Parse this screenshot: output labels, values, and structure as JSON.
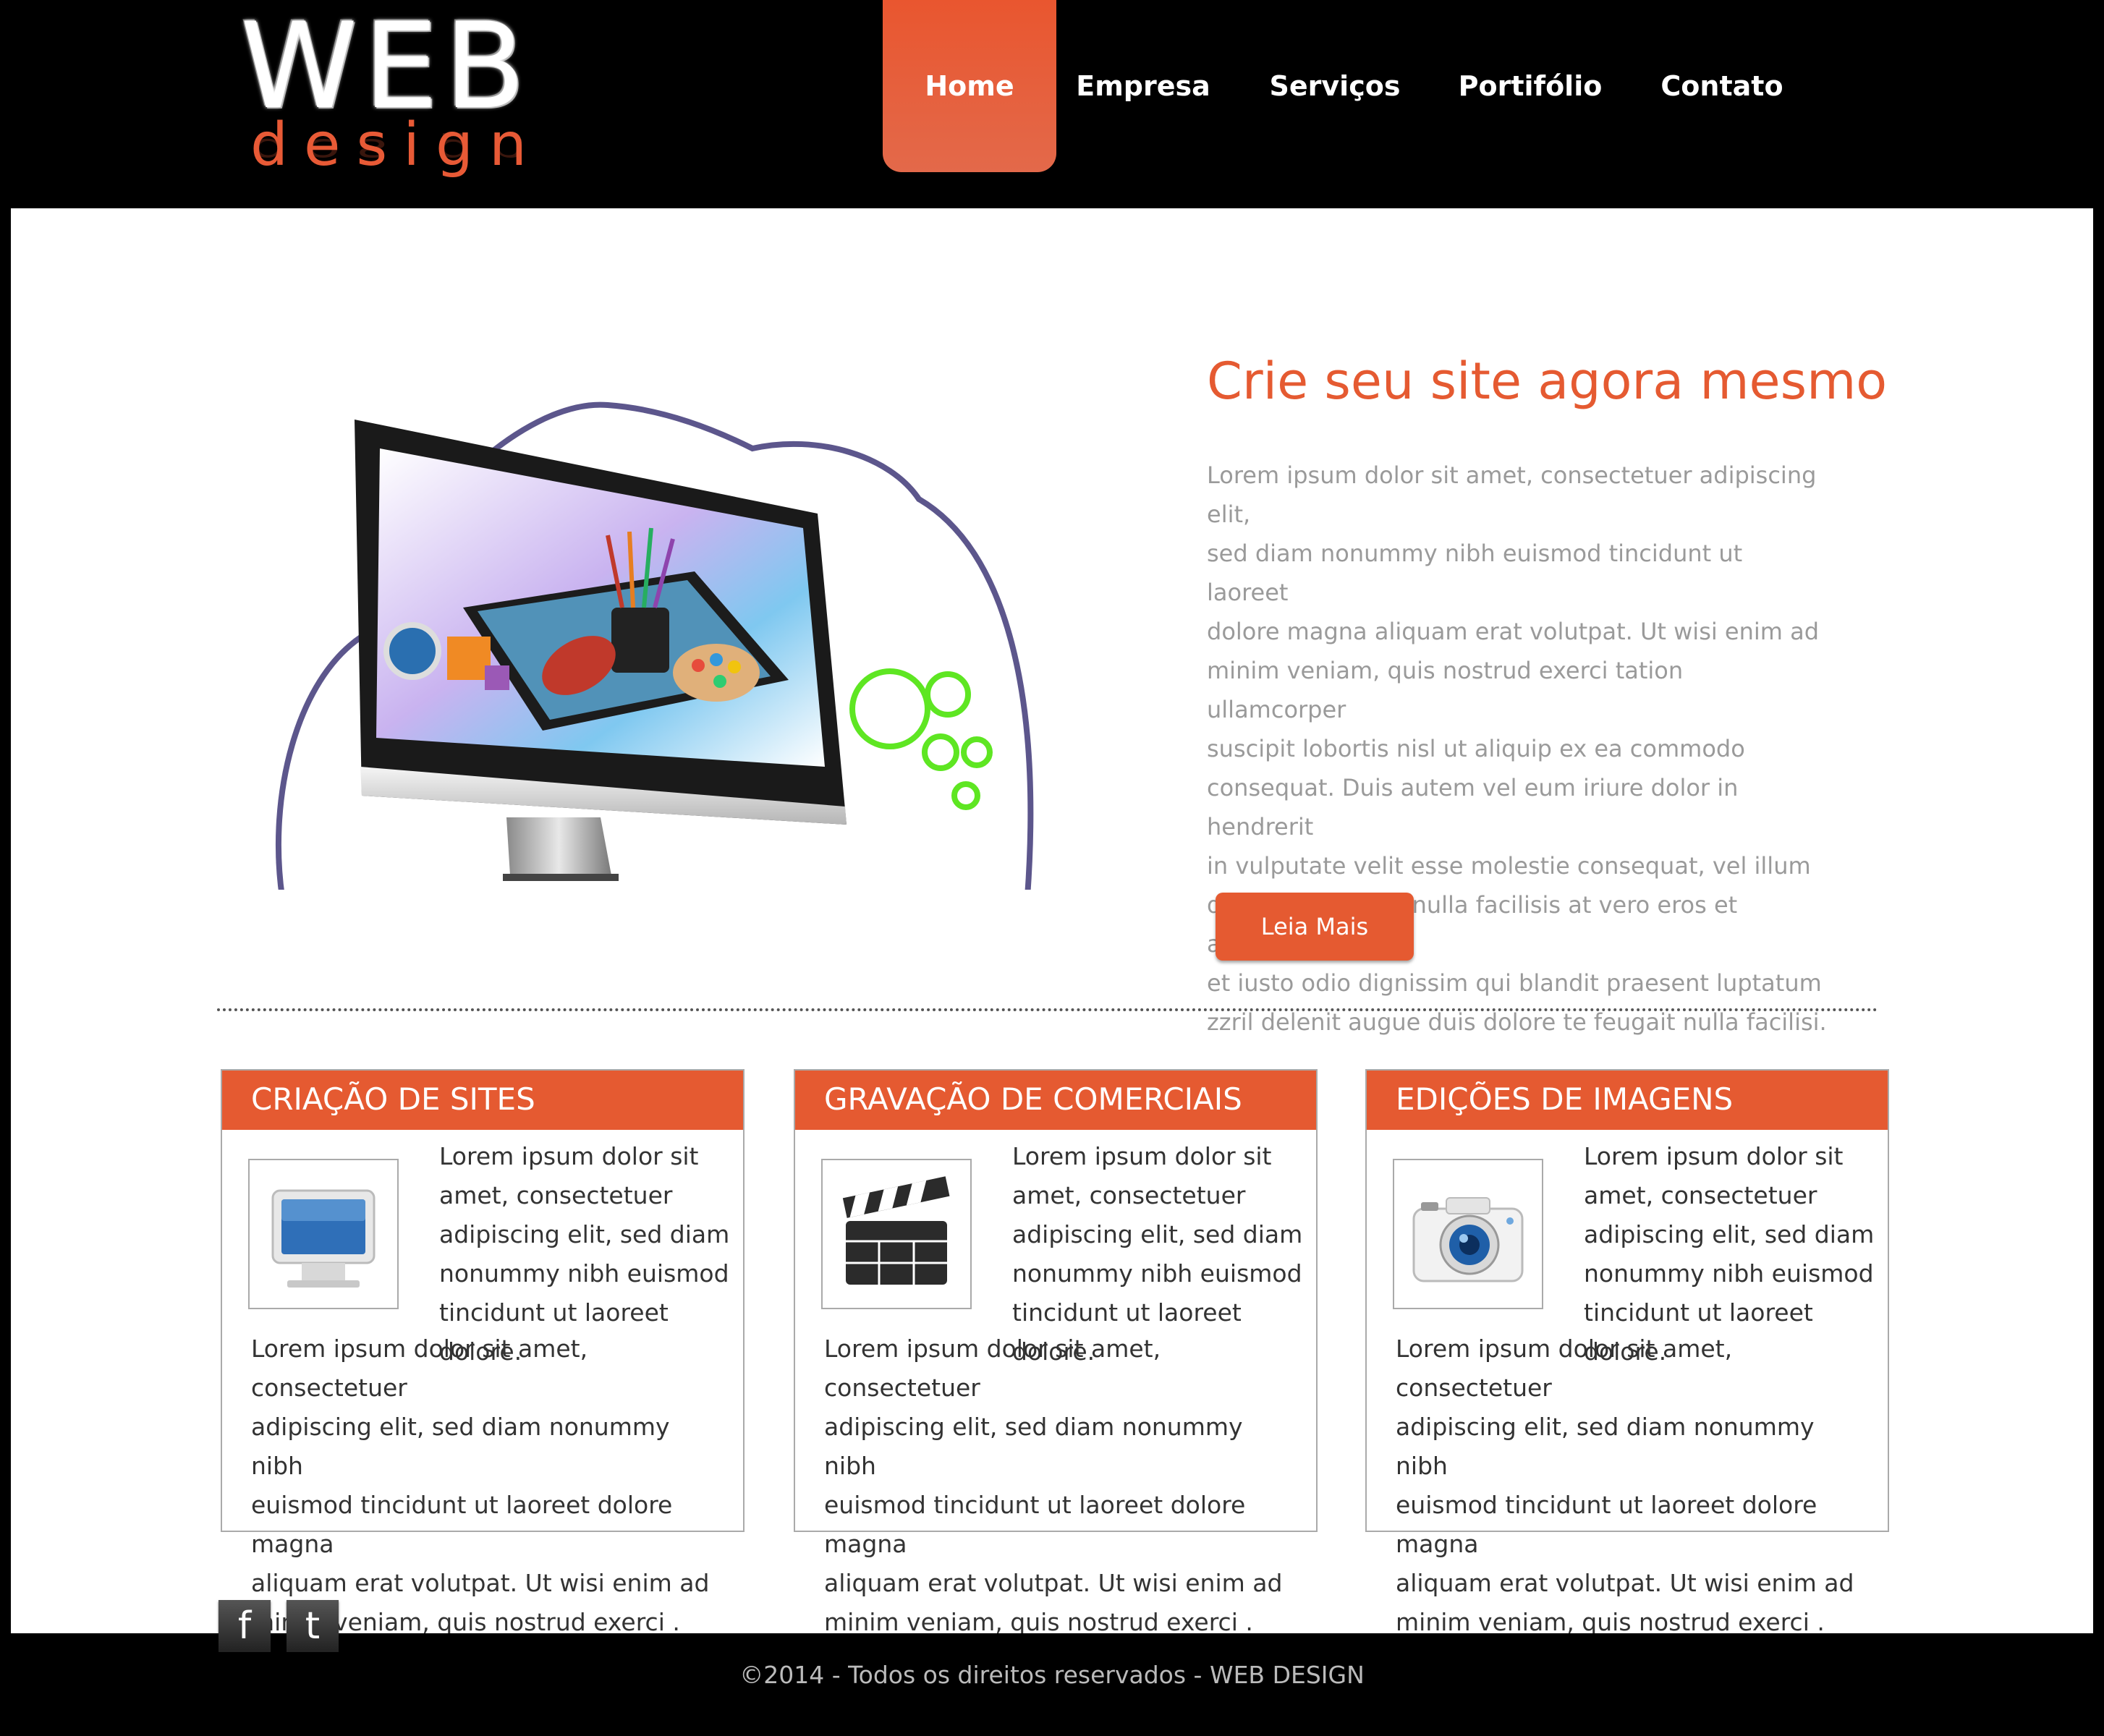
{
  "logo": {
    "line1": "WEB",
    "line2": "design"
  },
  "nav": {
    "items": [
      {
        "label": "Home",
        "active": true
      },
      {
        "label": "Empresa",
        "active": false
      },
      {
        "label": "Serviços",
        "active": false
      },
      {
        "label": "Portifólio",
        "active": false
      },
      {
        "label": "Contato",
        "active": false
      }
    ]
  },
  "hero": {
    "title": "Crie seu site agora mesmo",
    "text_lines": [
      "Lorem ipsum dolor sit amet, consectetuer adipiscing elit,",
      "sed diam nonummy nibh euismod tincidunt ut laoreet",
      "dolore magna aliquam erat volutpat. Ut wisi enim ad",
      "minim veniam, quis nostrud exerci tation ullamcorper",
      "suscipit lobortis nisl ut aliquip ex ea commodo",
      "consequat. Duis autem vel eum iriure dolor in hendrerit",
      "in vulputate velit esse molestie consequat, vel illum",
      "dolore eu feugiat nulla facilisis at vero eros et accumsan",
      "et iusto odio dignissim qui blandit praesent luptatum",
      "zzril delenit augue duis dolore te feugait nulla facilisi."
    ],
    "button_label": "Leia Mais"
  },
  "cards": [
    {
      "title": "CRIAÇÃO DE SITES",
      "icon": "monitor-icon",
      "short_lines": [
        "Lorem ipsum dolor sit",
        "amet, consectetuer",
        "adipiscing elit, sed diam",
        "nonummy nibh euismod",
        "tincidunt ut laoreet dolore."
      ],
      "long_lines": [
        "Lorem ipsum dolor sit amet, consectetuer",
        "adipiscing elit, sed diam nonummy nibh",
        "euismod tincidunt ut laoreet dolore magna",
        "aliquam erat volutpat. Ut wisi enim ad",
        "minim veniam, quis nostrud exerci ."
      ]
    },
    {
      "title": "GRAVAÇÃO DE COMERCIAIS",
      "icon": "clapperboard-icon",
      "short_lines": [
        "Lorem ipsum dolor sit",
        "amet, consectetuer",
        "adipiscing elit, sed diam",
        "nonummy nibh euismod",
        "tincidunt ut laoreet dolore."
      ],
      "long_lines": [
        "Lorem ipsum dolor sit amet, consectetuer",
        "adipiscing elit, sed diam nonummy nibh",
        "euismod tincidunt ut laoreet dolore magna",
        "aliquam erat volutpat. Ut wisi enim ad",
        "minim veniam, quis nostrud exerci ."
      ]
    },
    {
      "title": "EDIÇÕES DE IMAGENS",
      "icon": "camera-icon",
      "short_lines": [
        "Lorem ipsum dolor sit",
        "amet, consectetuer",
        "adipiscing elit, sed diam",
        "nonummy nibh euismod",
        "tincidunt ut laoreet dolore."
      ],
      "long_lines": [
        "Lorem ipsum dolor sit amet, consectetuer",
        "adipiscing elit, sed diam nonummy nibh",
        "euismod tincidunt ut laoreet dolore magna",
        "aliquam erat volutpat. Ut wisi enim ad",
        "minim veniam, quis nostrud exerci ."
      ]
    }
  ],
  "social": {
    "facebook": "f",
    "twitter": "t"
  },
  "footer": {
    "copyright": "©2014 - Todos os direitos reservados - WEB DESIGN"
  },
  "colors": {
    "accent": "#e55a31",
    "header_bg": "#000000",
    "panel_bg": "#ffffff",
    "body_text": "#9a9a9a"
  }
}
